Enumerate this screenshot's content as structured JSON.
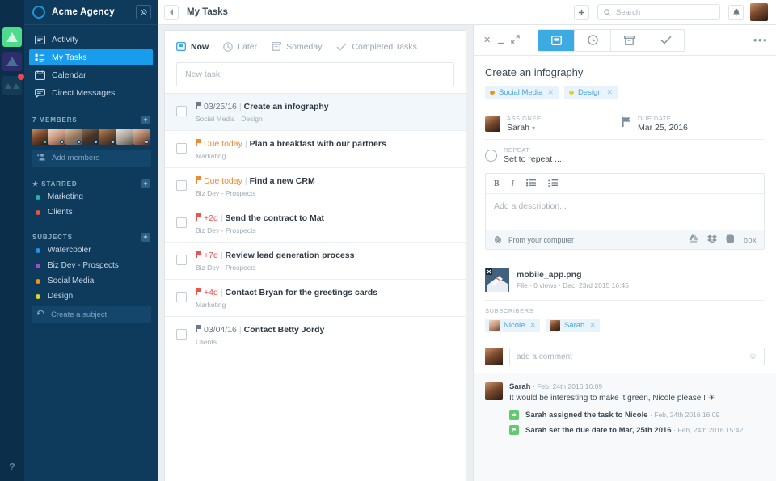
{
  "rail": {
    "tiles": [
      {
        "name": "workspace-green",
        "badge": false
      },
      {
        "name": "workspace-purple",
        "badge": false
      },
      {
        "name": "workspace-muted",
        "badge": true
      }
    ],
    "help_label": "?"
  },
  "sidebar": {
    "logo_icon": "circle-logo-icon",
    "title": "Acme Agency",
    "gear_icon": "gear-icon",
    "nav": [
      {
        "label": "Activity",
        "icon": "activity-icon",
        "active": false
      },
      {
        "label": "My Tasks",
        "icon": "tasks-icon",
        "active": true
      },
      {
        "label": "Calendar",
        "icon": "calendar-icon",
        "active": false
      },
      {
        "label": "Direct Messages",
        "icon": "messages-icon",
        "active": false
      }
    ],
    "members": {
      "header": "7 MEMBERS",
      "add_label": "Add members",
      "add_icon": "add-person-icon",
      "count": 7,
      "statuses": [
        "#5fd27a",
        "#c6ccd2",
        "#c6ccd2",
        "#c6ccd2",
        "#c6ccd2",
        "",
        "#c6ccd2"
      ]
    },
    "starred": {
      "header": "STARRED",
      "star_icon": "star-icon",
      "items": [
        {
          "label": "Marketing",
          "color": "#1fb89a"
        },
        {
          "label": "Clients",
          "color": "#e8543f"
        }
      ]
    },
    "subjects": {
      "header": "SUBJECTS",
      "items": [
        {
          "label": "Watercooler",
          "color": "#2e8fe0"
        },
        {
          "label": "Biz Dev - Prospects",
          "color": "#9b4fc9"
        },
        {
          "label": "Social Media",
          "color": "#e8960f"
        },
        {
          "label": "Design",
          "color": "#ddd329"
        }
      ],
      "create_label": "Create a subject",
      "create_icon": "refresh-icon"
    }
  },
  "topbar": {
    "back_icon": "chevron-left-icon",
    "title": "My Tasks",
    "add_icon": "plus-icon",
    "search_icon": "search-icon",
    "search_placeholder": "Search",
    "bell_icon": "bell-icon",
    "avatar_name": "user-avatar"
  },
  "tasklist": {
    "tabs": [
      {
        "label": "Now",
        "icon": "now-icon",
        "active": true
      },
      {
        "label": "Later",
        "icon": "clock-icon",
        "active": false
      },
      {
        "label": "Someday",
        "icon": "archive-icon",
        "active": false
      },
      {
        "label": "Completed Tasks",
        "icon": "check-icon",
        "active": false
      }
    ],
    "new_task_placeholder": "New task",
    "rows": [
      {
        "due": "03/25/16",
        "due_state": "gray",
        "title": "Create an infography",
        "sub": "Social Media · Design",
        "selected": true
      },
      {
        "due": "Due today",
        "due_state": "orange",
        "title": "Plan a breakfast with our partners",
        "sub": "Marketing",
        "selected": false
      },
      {
        "due": "Due today",
        "due_state": "orange",
        "title": "Find a new CRM",
        "sub": "Biz Dev - Prospects",
        "selected": false
      },
      {
        "due": "+2d",
        "due_state": "red",
        "title": "Send the contract to Mat",
        "sub": "Biz Dev - Prospects",
        "selected": false
      },
      {
        "due": "+7d",
        "due_state": "red",
        "title": "Review lead generation process",
        "sub": "Biz Dev - Prospects",
        "selected": false
      },
      {
        "due": "+4d",
        "due_state": "red",
        "title": "Contact Bryan for the greetings cards",
        "sub": "Marketing",
        "selected": false
      },
      {
        "due": "03/04/16",
        "due_state": "gray",
        "title": "Contact Betty Jordy",
        "sub": "Clients",
        "selected": false
      }
    ],
    "separator": "|"
  },
  "detail": {
    "window": {
      "close_icon": "close-icon",
      "minimize_icon": "minimize-icon",
      "expand_icon": "expand-icon",
      "more_icon": "more-options-icon"
    },
    "tabs": [
      {
        "icon": "now-icon",
        "active": true
      },
      {
        "icon": "clock-icon",
        "active": false
      },
      {
        "icon": "archive-icon",
        "active": false
      },
      {
        "icon": "check-icon",
        "active": false
      }
    ],
    "title": "Create an infography",
    "chips": [
      {
        "label": "Social Media",
        "color": "#e8960f"
      },
      {
        "label": "Design",
        "color": "#ddd329"
      }
    ],
    "assignee": {
      "label": "ASSIGNEE",
      "value": "Sarah",
      "caret_icon": "chevron-down-icon"
    },
    "due_date": {
      "label": "DUE DATE",
      "value": "Mar 25, 2016",
      "flag_icon": "flag-icon"
    },
    "repeat": {
      "label": "REPEAT",
      "value": "Set to repeat ...",
      "icon": "repeat-icon"
    },
    "editor": {
      "tools": [
        "bold-icon",
        "italic-icon",
        "bullet-list-icon",
        "check-list-icon"
      ],
      "tool_labels": [
        "B",
        "I"
      ],
      "placeholder": "Add a description...",
      "upload_label": "From your computer",
      "upload_icon": "paperclip-icon",
      "services": [
        "google-drive-icon",
        "dropbox-icon",
        "evernote-icon",
        "box-icon"
      ],
      "box_label": "box"
    },
    "file": {
      "name": "mobile_app.png",
      "meta": "File · 0 views · Dec, 23rd 2015 16:45",
      "thumb_icon": "image-file-icon"
    },
    "subscribers": {
      "header": "SUBSCRIBERS",
      "items": [
        {
          "name": "Nicole",
          "avatar": "nicole-avatar"
        },
        {
          "name": "Sarah",
          "avatar": "sarah-avatar"
        }
      ]
    },
    "comment_box": {
      "placeholder": "add a comment",
      "emoji_icon": "smiley-icon",
      "avatar": "user-avatar"
    },
    "feed": [
      {
        "kind": "comment",
        "author": "Sarah",
        "when": "· Feb, 24th 2016 16:09",
        "text": "It would be interesting to make it green, Nicole please ! ☀"
      },
      {
        "kind": "activity",
        "icon": "assign-icon",
        "text": "Sarah assigned the task to Nicole",
        "when": "· Feb, 24th 2016 16:09"
      },
      {
        "kind": "activity",
        "icon": "flag-icon",
        "text": "Sarah set the due date to Mar, 25th 2016",
        "when": "· Feb, 24th 2016 15:42"
      }
    ]
  },
  "colors": {
    "accent": "#189cec",
    "sidebar_bg": "#0e3a5c",
    "rail_bg": "#0b2f4a",
    "tab_active": "#3cabe2",
    "due_orange": "#f08a33",
    "due_red": "#ef5350"
  }
}
